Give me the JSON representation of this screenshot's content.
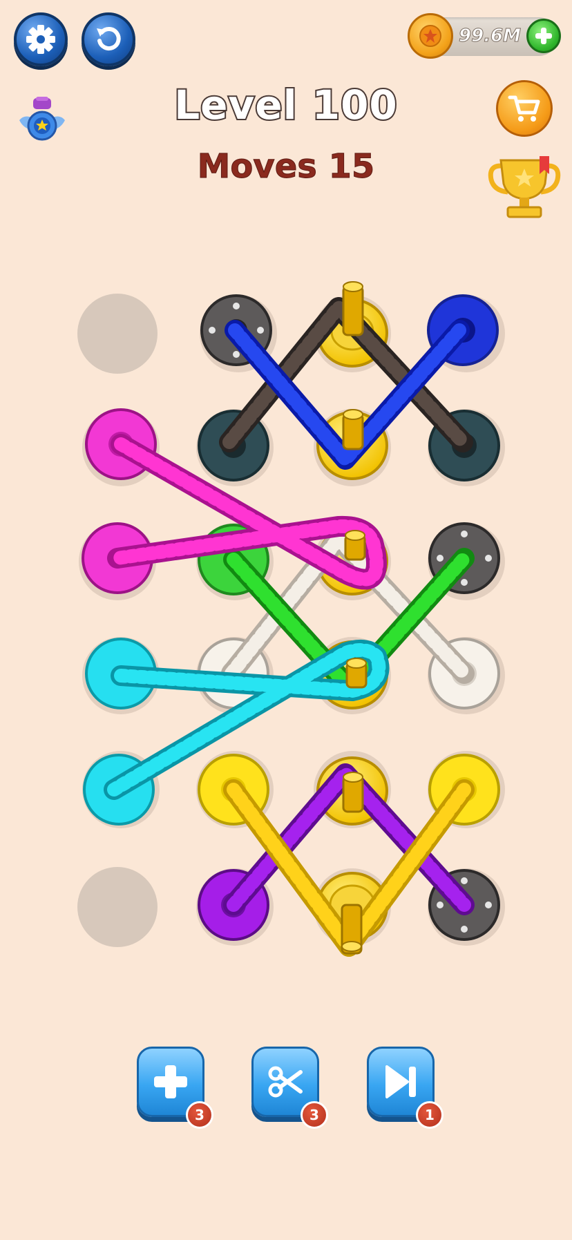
{
  "header": {
    "coins": "99.6M",
    "level_title": "Level 100",
    "moves_title": "Moves 15"
  },
  "icons": {
    "settings": "gear-icon",
    "restart": "restart-icon",
    "coin": "coin-icon",
    "add_coins": "plus-icon",
    "badge": "badge-icon",
    "shop": "cart-icon",
    "trophy": "trophy-icon"
  },
  "board": {
    "rows": 6,
    "columns": 4
  },
  "powerups": [
    {
      "name": "add-hole",
      "icon": "plus-icon",
      "count": "3"
    },
    {
      "name": "cut-rope",
      "icon": "scissors-icon",
      "count": "3"
    },
    {
      "name": "skip-level",
      "icon": "skip-icon",
      "count": "1"
    }
  ],
  "colors": {
    "background": "#fbe7d6",
    "button_blue": "#39a6f2",
    "moves_red": "#8a2a1e",
    "pink": "#ff33cc",
    "cyan": "#1ee0ee",
    "green": "#22dd22",
    "blue": "#1533e6",
    "yellow": "#ffd21a",
    "purple": "#9b17e8",
    "white": "#f5efe6",
    "dark": "#3b3330"
  }
}
